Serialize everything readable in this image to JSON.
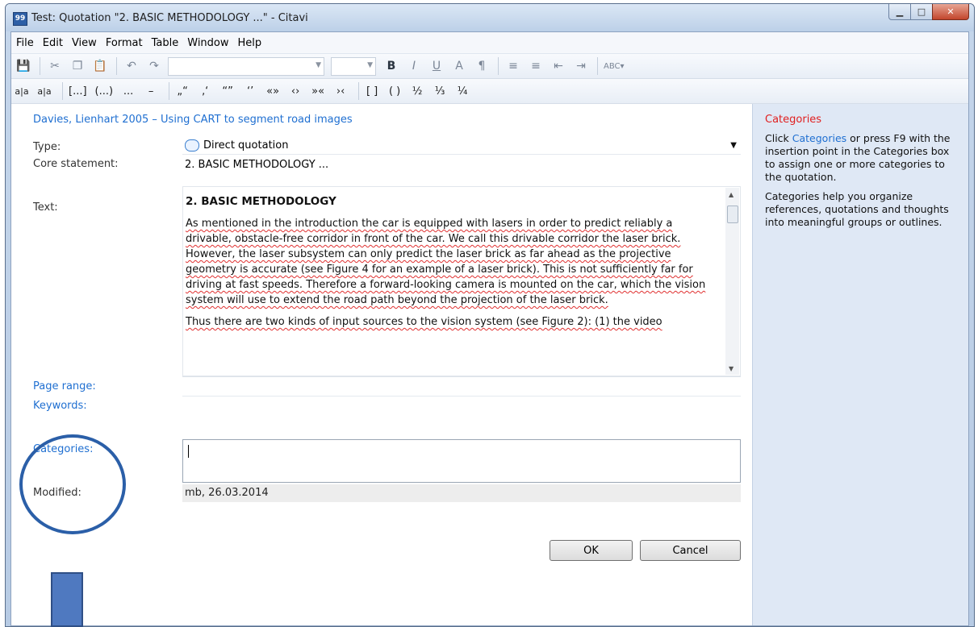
{
  "window": {
    "title": "Test: Quotation \"2. BASIC METHODOLOGY ...\" - Citavi",
    "app_icon": "99"
  },
  "menu": [
    "File",
    "Edit",
    "View",
    "Format",
    "Table",
    "Window",
    "Help"
  ],
  "toolbar2": {
    "items": [
      "a|a",
      "a|a",
      "[...]",
      "(...)",
      "...",
      "–",
      "„“",
      "‚‘",
      "“”",
      "‘’",
      "«»",
      "‹›",
      "»«",
      "›‹",
      "[ ]",
      "( )",
      "½",
      "⅓",
      "¼"
    ]
  },
  "reference": "Davies, Lienhart 2005 – Using CART to segment road images",
  "labels": {
    "type": "Type:",
    "core": "Core statement:",
    "text": "Text:",
    "page_range": "Page range:",
    "keywords": "Keywords:",
    "categories": "Categories:",
    "modified": "Modified:"
  },
  "type_value": "Direct quotation",
  "core_value": "2. BASIC METHODOLOGY ...",
  "text_heading": "2. BASIC METHODOLOGY",
  "text_p1": "As mentioned in the introduction the car is equipped with lasers in order to predict reliably a drivable, obstacle-free corridor in front of the car. We call this drivable corridor the laser brick. However, the laser subsystem can only predict the laser brick as far ahead as the projective geometry is accurate (see Figure 4 for an example of a laser brick). This is not sufficiently far for driving at fast speeds. Therefore a forward-looking camera is mounted on the car, which the vision system will use to extend the road path beyond the projection of the laser brick.",
  "text_p2": "Thus there are two kinds of input sources to the vision system (see Figure 2): (1) the video",
  "modified_value": "mb, 26.03.2014",
  "buttons": {
    "ok": "OK",
    "cancel": "Cancel"
  },
  "side": {
    "title": "Categories",
    "p1_link": "Categories",
    "p1_pre": "Click ",
    "p1_post": " or press F9 with the insertion point in the Categories box to assign one or more categories to the quotation.",
    "p2": "Categories help you organize references, quotations and thoughts into meaningful groups or outlines."
  },
  "colors": {
    "link": "#1f6fd1",
    "side_title": "#e02020",
    "annotation": "#2b5fa8"
  }
}
